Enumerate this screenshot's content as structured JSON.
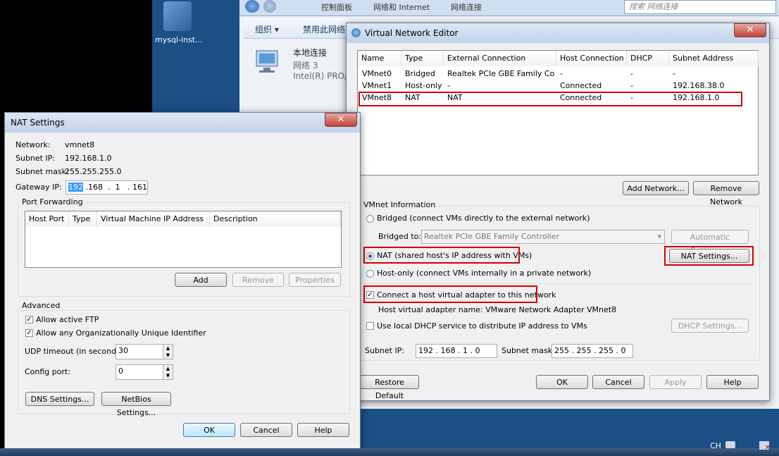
{
  "desktop": {
    "icon_label": "mysql-inst..."
  },
  "explorer": {
    "breadcrumbs": [
      "控制面板",
      "网络和 Internet",
      "网络连接"
    ],
    "search_placeholder": "搜索 网络连接",
    "cmd_items": [
      "组织 ▾",
      "禁用此网络"
    ],
    "connection": {
      "name": "本地连接",
      "network": "网络  3",
      "adapter": "Intel(R) PRO/"
    }
  },
  "vne": {
    "title": "Virtual Network Editor",
    "columns": [
      "Name",
      "Type",
      "External Connection",
      "Host Connection",
      "DHCP",
      "Subnet Address"
    ],
    "rows": [
      [
        "VMnet0",
        "Bridged",
        "Realtek PCIe GBE Family Co...",
        "-",
        "-",
        "-"
      ],
      [
        "VMnet1",
        "Host-only",
        "-",
        "Connected",
        "-",
        "192.168.38.0"
      ],
      [
        "VMnet8",
        "NAT",
        "NAT",
        "Connected",
        "-",
        "192.168.1.0"
      ]
    ],
    "add_network": "Add Network...",
    "remove_network": "Remove Network",
    "vmnet_info": "VMnet Information",
    "bridged_label": "Bridged (connect VMs directly to the external network)",
    "bridged_to_label": "Bridged to:",
    "bridged_to_value": "Realtek PCIe GBE Family Controller",
    "auto_settings": "Automatic Settings...",
    "nat_label": "NAT (shared host's IP address with VMs)",
    "nat_settings": "NAT Settings...",
    "hostonly_label": "Host-only (connect VMs internally in a private network)",
    "connect_adapter_label": "Connect a host virtual adapter to this network",
    "adapter_name": "Host virtual adapter name: VMware Network Adapter VMnet8",
    "dhcp_label": "Use local DHCP service to distribute IP address to VMs",
    "dhcp_settings": "DHCP Settings...",
    "subnet_ip_label": "Subnet IP:",
    "subnet_ip": "192 . 168 .  1  .  0",
    "subnet_mask_label": "Subnet mask:",
    "subnet_mask": "255 . 255 . 255 .  0",
    "restore_default": "Restore Default",
    "ok": "OK",
    "cancel": "Cancel",
    "apply": "Apply",
    "help": "Help"
  },
  "nat": {
    "title": "NAT Settings",
    "network_label": "Network:",
    "network_value": "vmnet8",
    "subnet_ip_label": "Subnet IP:",
    "subnet_ip_value": "192.168.1.0",
    "subnet_mask_label": "Subnet mask:",
    "subnet_mask_value": "255.255.255.0",
    "gateway_label": "Gateway IP:",
    "gateway_first": "192",
    "gateway_rest": " .168  .  1   . 161",
    "port_forwarding": "Port Forwarding",
    "pf_columns": [
      "Host Port",
      "Type",
      "Virtual Machine IP Address",
      "Description"
    ],
    "add": "Add",
    "remove": "Remove",
    "properties": "Properties",
    "advanced": "Advanced",
    "allow_ftp": "Allow active FTP",
    "allow_oui": "Allow any Organizationally Unique Identifier",
    "udp_label": "UDP timeout (in seconds):",
    "udp_value": "30",
    "config_port_label": "Config port:",
    "config_port_value": "0",
    "dns_settings": "DNS Settings...",
    "netbios_settings": "NetBios Settings...",
    "ok": "OK",
    "cancel": "Cancel",
    "help": "Help"
  },
  "tray": {
    "lang": "CH"
  }
}
